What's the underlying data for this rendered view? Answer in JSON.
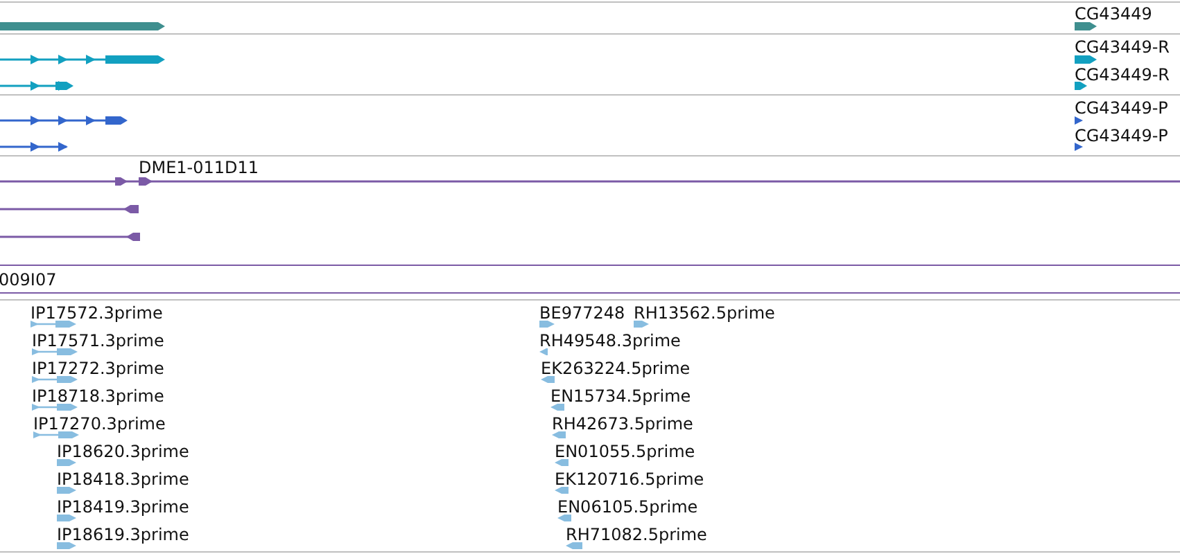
{
  "tracks": [
    {
      "kind": "gene",
      "color": "#3f8f8f",
      "features": [
        {
          "label": "CG43449"
        }
      ]
    },
    {
      "kind": "transcript",
      "color": "#12a0c0",
      "features": [
        {
          "label": "CG43449-R"
        },
        {
          "label": "CG43449-R"
        }
      ]
    },
    {
      "kind": "protein",
      "color": "#3366cc",
      "features": [
        {
          "label": "CG43449-P"
        },
        {
          "label": "CG43449-P"
        }
      ]
    },
    {
      "kind": "clone",
      "color": "#7b5aa6",
      "features": [
        {
          "label": "DME1-011D11"
        }
      ]
    },
    {
      "kind": "clone_end",
      "features": [
        {
          "label": "009I07"
        }
      ]
    },
    {
      "kind": "est",
      "color": "#88bde0",
      "features": [
        {
          "label": "IP17572.3prime"
        },
        {
          "label": "IP17571.3prime"
        },
        {
          "label": "IP17272.3prime"
        },
        {
          "label": "IP18718.3prime"
        },
        {
          "label": "IP17270.3prime"
        },
        {
          "label": "IP18620.3prime"
        },
        {
          "label": "IP18418.3prime"
        },
        {
          "label": "IP18419.3prime"
        },
        {
          "label": "IP18619.3prime"
        },
        {
          "label": "BE977248"
        },
        {
          "label": "RH13562.5prime"
        },
        {
          "label": "RH49548.3prime"
        },
        {
          "label": "EK263224.5prime"
        },
        {
          "label": "EN15734.5prime"
        },
        {
          "label": "RH42673.5prime"
        },
        {
          "label": "EN01055.5prime"
        },
        {
          "label": "EK120716.5prime"
        },
        {
          "label": "EN06105.5prime"
        },
        {
          "label": "RH71082.5prime"
        }
      ]
    }
  ]
}
